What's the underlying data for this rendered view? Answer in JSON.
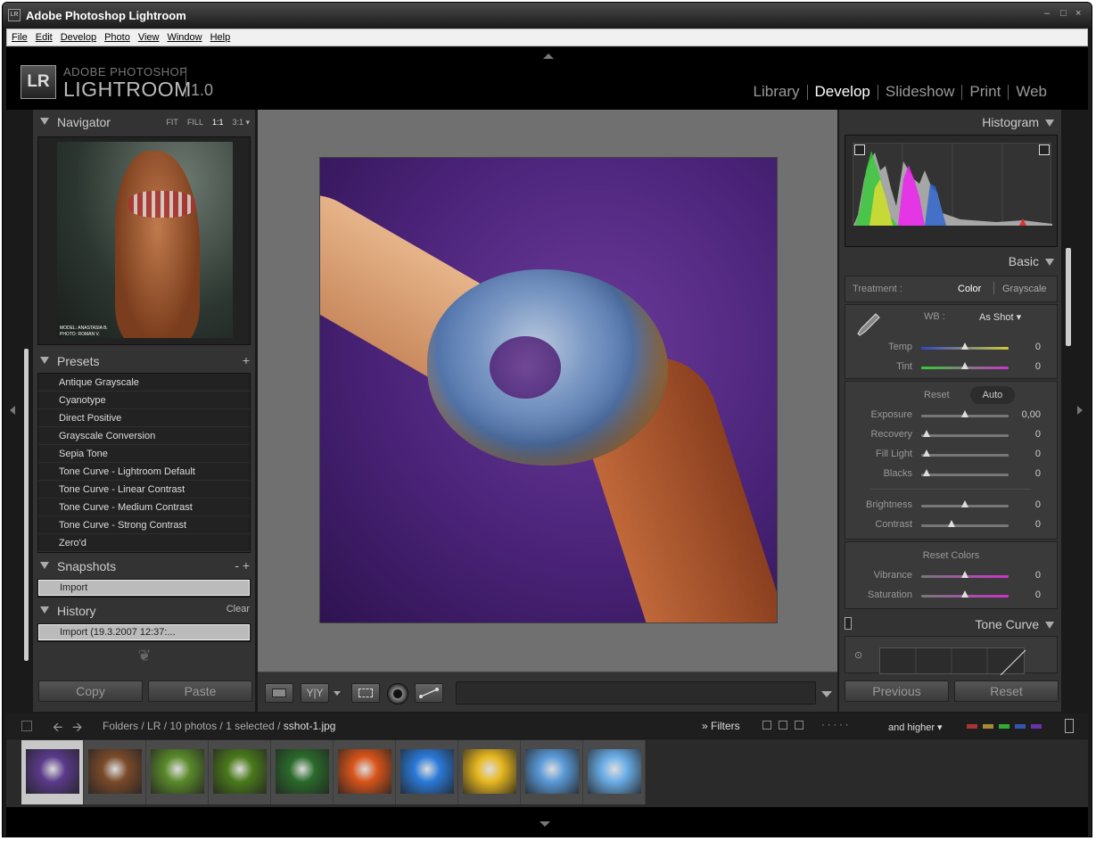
{
  "window": {
    "title": "Adobe Photoshop Lightroom",
    "controls": [
      "–",
      "□",
      "×"
    ]
  },
  "menu": [
    "File",
    "Edit",
    "Develop",
    "Photo",
    "View",
    "Window",
    "Help"
  ],
  "brand": {
    "logo": "LR",
    "line1": "ADOBE PHOTOSHOP",
    "line2": "LIGHTROOM",
    "version": "1.0"
  },
  "modules": [
    {
      "label": "Library",
      "active": false
    },
    {
      "label": "Develop",
      "active": true
    },
    {
      "label": "Slideshow",
      "active": false
    },
    {
      "label": "Print",
      "active": false
    },
    {
      "label": "Web",
      "active": false
    }
  ],
  "navigator": {
    "title": "Navigator",
    "zoom": [
      "FIT",
      "FILL",
      "1:1",
      "3:1 ▾"
    ],
    "caption1": "MODEL: ANASTASIA B.",
    "caption2": "PHOTO: ROMAN V."
  },
  "presets": {
    "title": "Presets",
    "add": "+",
    "items": [
      "Antique Grayscale",
      "Cyanotype",
      "Direct Positive",
      "Grayscale Conversion",
      "Sepia Tone",
      "Tone Curve - Lightroom Default",
      "Tone Curve - Linear Contrast",
      "Tone Curve - Medium Contrast",
      "Tone Curve - Strong Contrast",
      "Zero'd"
    ]
  },
  "snapshots": {
    "title": "Snapshots",
    "actions": "-  +",
    "item": "Import"
  },
  "history": {
    "title": "History",
    "clear": "Clear",
    "item": "Import (19.3.2007 12:37:..."
  },
  "left_buttons": {
    "copy": "Copy",
    "paste": "Paste"
  },
  "histogram": {
    "title": "Histogram"
  },
  "basic": {
    "title": "Basic",
    "treatment_label": "Treatment :",
    "treatment_color": "Color",
    "treatment_gray": "Grayscale",
    "wb_label": "WB :",
    "wb_value": "As Shot ▾",
    "reset": "Reset",
    "auto": "Auto",
    "reset_colors": "Reset Colors",
    "sliders": [
      {
        "label": "Temp",
        "value": "0"
      },
      {
        "label": "Tint",
        "value": "0"
      },
      {
        "label": "Exposure",
        "value": "0,00"
      },
      {
        "label": "Recovery",
        "value": "0"
      },
      {
        "label": "Fill Light",
        "value": "0"
      },
      {
        "label": "Blacks",
        "value": "0"
      },
      {
        "label": "Brightness",
        "value": "0"
      },
      {
        "label": "Contrast",
        "value": "0"
      },
      {
        "label": "Vibrance",
        "value": "0"
      },
      {
        "label": "Saturation",
        "value": "0"
      }
    ]
  },
  "tone_curve": {
    "title": "Tone Curve"
  },
  "right_buttons": {
    "previous": "Previous",
    "reset": "Reset"
  },
  "filmstrip": {
    "path": "Folders / LR / 10 photos / 1 selected / ",
    "file": "sshot-1.jpg",
    "filters": "» Filters",
    "rating": "·  ·  ·  ·  ·",
    "higher": "and higher ▾",
    "flag_colors": [
      "#a33",
      "#a83",
      "#3a3",
      "#35a",
      "#63a"
    ],
    "thumb_colors": [
      "#5a3a8a",
      "#7a4a2a",
      "#5a8a2a",
      "#4a7a1a",
      "#2a6a2a",
      "#d8541a",
      "#2a7ad8",
      "#e8b820",
      "#5a9ad8",
      "#6aaee8"
    ]
  }
}
